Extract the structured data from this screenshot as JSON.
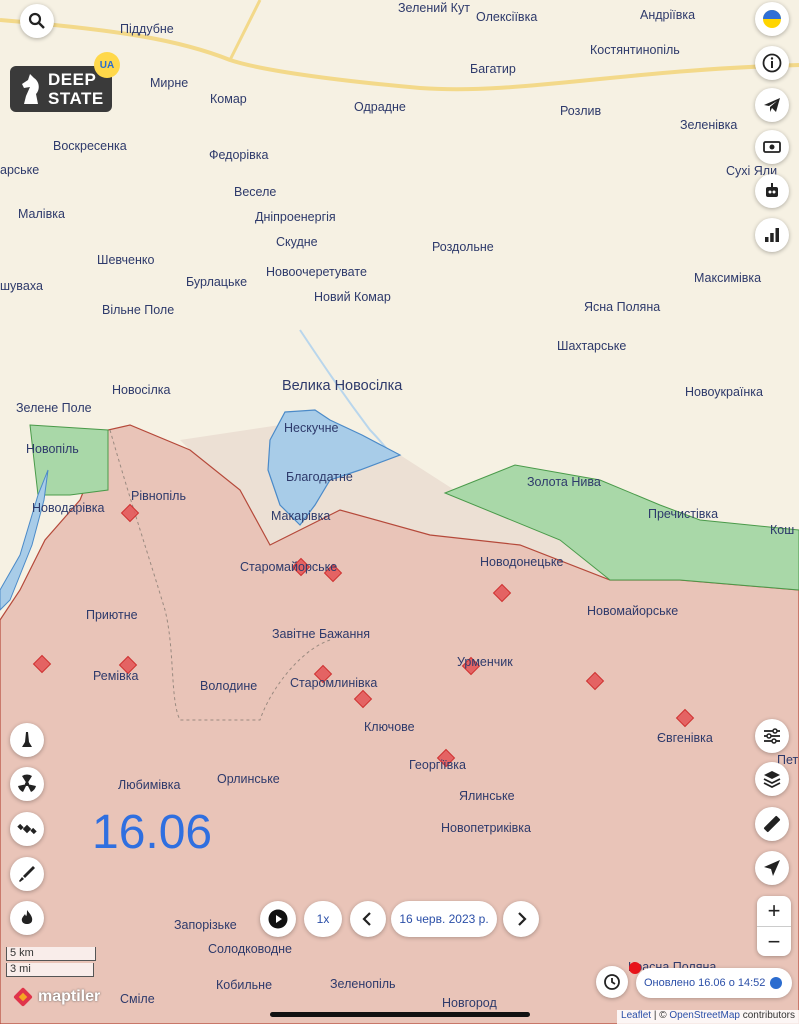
{
  "map": {
    "date_label": "16.06",
    "places": [
      {
        "name": "Піддубне",
        "big": false
      },
      {
        "name": "Зелений Кут",
        "big": false
      },
      {
        "name": "Олексіївка",
        "big": false
      },
      {
        "name": "Андріївка",
        "big": false
      },
      {
        "name": "Костянтинопіль",
        "big": false
      },
      {
        "name": "Мирне",
        "big": false
      },
      {
        "name": "Комар",
        "big": false
      },
      {
        "name": "Багатир",
        "big": false
      },
      {
        "name": "Одрадне",
        "big": false
      },
      {
        "name": "Розлив",
        "big": false
      },
      {
        "name": "Зеленівка",
        "big": false
      },
      {
        "name": "Воскресенка",
        "big": false
      },
      {
        "name": "Федорівка",
        "big": false
      },
      {
        "name": "Сухі Яли",
        "big": false
      },
      {
        "name": "арське",
        "big": false
      },
      {
        "name": "Веселе",
        "big": false
      },
      {
        "name": "Малівка",
        "big": false
      },
      {
        "name": "Дніпроенергія",
        "big": false
      },
      {
        "name": "Скудне",
        "big": false
      },
      {
        "name": "Роздольне",
        "big": false
      },
      {
        "name": "Шевченко",
        "big": false
      },
      {
        "name": "Новоочеретувате",
        "big": false
      },
      {
        "name": "Максимівка",
        "big": false
      },
      {
        "name": "шувaха",
        "big": false
      },
      {
        "name": "Бурлацьке",
        "big": false
      },
      {
        "name": "Новий Комар",
        "big": false
      },
      {
        "name": "Вільне Поле",
        "big": false
      },
      {
        "name": "Ясна Поляна",
        "big": false
      },
      {
        "name": "Шахтарське",
        "big": false
      },
      {
        "name": "Новосілка",
        "big": false
      },
      {
        "name": "Велика Новосілка",
        "big": true
      },
      {
        "name": "Новоукраїнка",
        "big": false
      },
      {
        "name": "Зелене Поле",
        "big": false
      },
      {
        "name": "Нескучне",
        "big": false
      },
      {
        "name": "Новопіль",
        "big": false
      },
      {
        "name": "Благодатне",
        "big": false
      },
      {
        "name": "Золота Нива",
        "big": false
      },
      {
        "name": "Рівнопіль",
        "big": false
      },
      {
        "name": "Пречистівка",
        "big": false
      },
      {
        "name": "Новодарівка",
        "big": false
      },
      {
        "name": "Макарівка",
        "big": false
      },
      {
        "name": "Кош",
        "big": false
      },
      {
        "name": "Старомайорське",
        "big": false
      },
      {
        "name": "Новодонецьке",
        "big": false
      },
      {
        "name": "Приютне",
        "big": false
      },
      {
        "name": "Новомайорське",
        "big": false
      },
      {
        "name": "Завітне Бажання",
        "big": false
      },
      {
        "name": "Урменчик",
        "big": false
      },
      {
        "name": "Ремівка",
        "big": false
      },
      {
        "name": "Володине",
        "big": false
      },
      {
        "name": "Старомлинівка",
        "big": false
      },
      {
        "name": "Ключове",
        "big": false
      },
      {
        "name": "Євгенівка",
        "big": false
      },
      {
        "name": "Петр",
        "big": false
      },
      {
        "name": "Георгіївка",
        "big": false
      },
      {
        "name": "Любимівка",
        "big": false
      },
      {
        "name": "Орлинське",
        "big": false
      },
      {
        "name": "Ялинське",
        "big": false
      },
      {
        "name": "Новопетриківка",
        "big": false
      },
      {
        "name": "Запорізьке",
        "big": false
      },
      {
        "name": "Солодководне",
        "big": false
      },
      {
        "name": "Красна Поляна",
        "big": false
      },
      {
        "name": "Кобильне",
        "big": false
      },
      {
        "name": "Зеленопіль",
        "big": false
      },
      {
        "name": "Сміле",
        "big": false
      },
      {
        "name": "Новгород",
        "big": false
      }
    ]
  },
  "logo": {
    "line1": "DEEP",
    "line2": "STATE",
    "badge": "UA"
  },
  "controls": {
    "speed": "1x",
    "current_date": "16 черв. 2023 р.",
    "zoom_in": "+",
    "zoom_out": "−",
    "updated": "Оновлено 16.06 о 14:52"
  },
  "scale": {
    "km": "5 km",
    "mi": "3 mi"
  },
  "branding": {
    "maptiler": "maptiler"
  },
  "attribution": {
    "leaflet": "Leaflet",
    "sep": " | © ",
    "osm": "OpenStreetMap",
    "contrib": " contributors"
  },
  "colors": {
    "occupied": "#e9c4b8",
    "liberated": "#a9d8a8",
    "contested_blue": "#a8cce8",
    "grey_zone": "#ece0d4",
    "accent": "#2b6ccf"
  },
  "icons": {
    "right": [
      "ukraine-flag-icon",
      "info-icon",
      "telegram-icon",
      "money-icon",
      "robot-icon",
      "chart-icon"
    ],
    "left": [
      "monument-icon",
      "radiation-icon",
      "satellite-icon",
      "rocket-icon",
      "fire-icon"
    ],
    "right_bottom": [
      "filter-icon",
      "layers-icon",
      "ruler-icon",
      "locate-icon"
    ]
  }
}
